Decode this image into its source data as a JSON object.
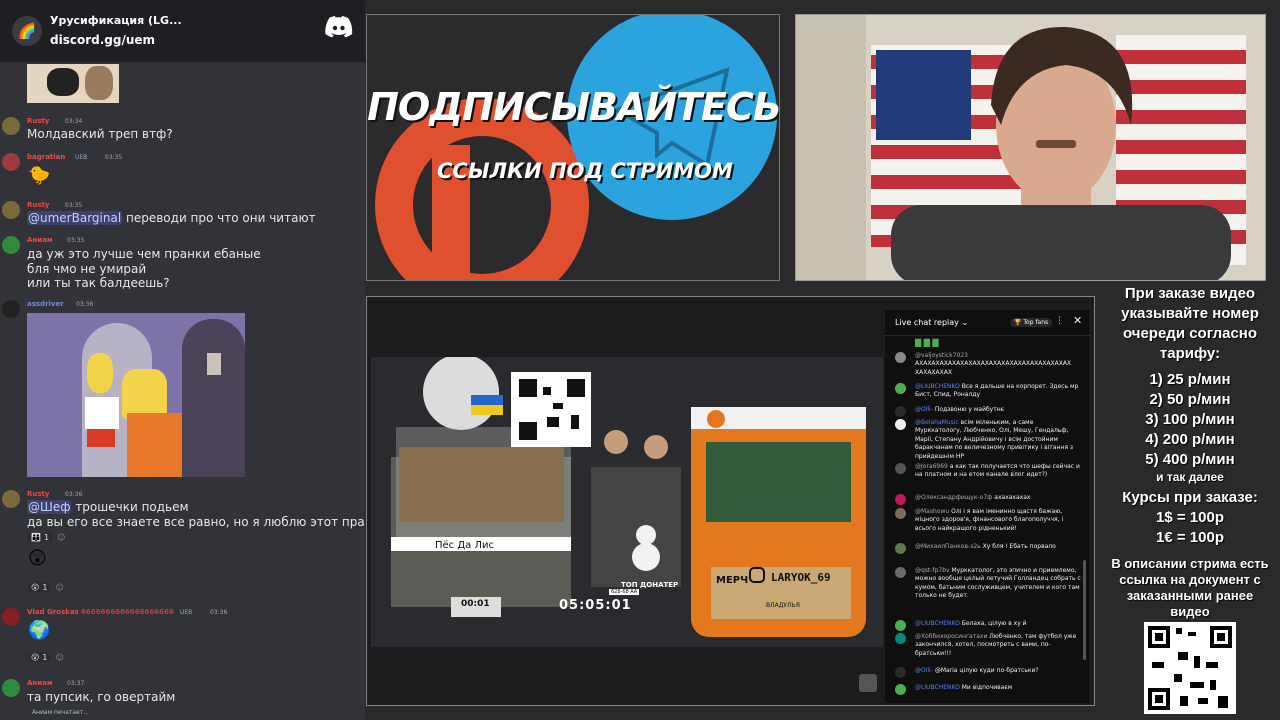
{
  "discord": {
    "server_name": "Урусификация (LG...",
    "invite": "discord.gg/uem",
    "typing": "Аниам печатает...",
    "messages": [
      {
        "user": "Rusty",
        "time": "03:34",
        "text": "Молдавский треп втф?"
      },
      {
        "user": "bagratian",
        "tag": "UEB",
        "time": "03:35"
      },
      {
        "user": "Rusty",
        "time": "03:35",
        "mention": "@umerBarginal",
        "text": "переводи про что они читают"
      },
      {
        "user": "Аниам",
        "time": "03:35",
        "lines": [
          "да уж это лучше чем пранки ебаные",
          "бля чмо не умирай",
          "или ты так балдеешь?"
        ]
      },
      {
        "user": "assdriver",
        "time": "03:36"
      },
      {
        "user": "Rusty",
        "time": "03:36",
        "mention": "@Шеф",
        "text": "трошечки подьем",
        "line2": "да вы его все знаете все равно, но я люблю этот пранк",
        "reaction_count": "1",
        "reaction2_count": "1"
      },
      {
        "user": "Vlad Groskas",
        "nick_suffix": "6666666666666666666",
        "tag": "UEB",
        "time": "03:36",
        "reaction_count": "1"
      },
      {
        "user": "Аниам",
        "time": "03:37",
        "text": "та пупсик, го овертайм"
      }
    ]
  },
  "promo": {
    "line1": "ПОДПИСЫВАЙТЕСЬ",
    "line2": "ССЫЛКИ ПОД СТРИМОМ"
  },
  "game": {
    "timer": "05:05:01",
    "left_plate": "Пёс Да Лис",
    "left_counter": "00:01",
    "merch_label": "МЕРЧ",
    "merch_handle": "LARYOK_69",
    "top_donater": "ТОП ДОНАТЕР",
    "plate_left": "628-68 АА",
    "plate_right": "ВЛАДУЛЬЯ"
  },
  "live_chat": {
    "title": "Live chat replay",
    "top_fans": "Top fans",
    "messages": [
      {
        "name": "@valjoystick7023",
        "text": "АХАХАХАХАХАХАХАХАХАХАХАХАХАХАХАХАХАХАХ ХАХАХАХАХ",
        "color": "#8a8a8a"
      },
      {
        "name": "@LIUBCHENKO",
        "mod": true,
        "text": "Все я дальше на корпорет. Здесь мр Бист, Спид, Роналду",
        "color": "#4caf50"
      },
      {
        "name": "@Olli-",
        "mod": true,
        "text": "Подзвоню у майбутнє",
        "color": "#2a2a2a"
      },
      {
        "name": "@BelahaMusic",
        "mod": true,
        "text": "всім міленьким, а саме Мурккатологу, Любченко, Олі, Мешу, Гендальф, Марії, Степану Андрійовичу і всім достойним баракчанам по величезному привітику і вітання з прийдешнім НР",
        "color": "#eeeeee"
      },
      {
        "name": "@Jora6969",
        "text": "а как так получается что шефы сейчас и на платном и на етом канале влог идет?)",
        "color": "#555555"
      },
      {
        "name": "@Олександрфищук-о7ф",
        "text": "ахахахахах",
        "color": "#c2185b"
      },
      {
        "name": "@Mashowu",
        "text": "Олі і я вам іменинно щастя бажаю, міцного здоров'я, фінансового благополуччя, і всього найкращого рідненький!",
        "color": "#7e6b5a"
      },
      {
        "name": "@МихаилПанков-з2ь",
        "text": "Ху бля ! Ебать порвало",
        "color": "#5d7a4a"
      },
      {
        "name": "@qst-fp7bv",
        "text": "Мурккатолог, это эпично и приемлемо, можно вообще целый летучий Голландец собрать с кумом, батьним сослуживцем, учителем и кого там только не будет.",
        "color": "#6b6b6b"
      },
      {
        "name": "@LIUBCHENKO",
        "mod": true,
        "text": "Белаха, цілую в ху й",
        "color": "#4caf50"
      },
      {
        "name": "@Хоббихоросингатахи",
        "text": "Любченко, там футбол уже закончился, хотел, посмотреть с вами, по-братськи!!!",
        "color": "#00897b"
      },
      {
        "name": "@Olli-",
        "mod": true,
        "text": "@Maria цілую куди по-братськи?",
        "color": "#2a2a2a"
      },
      {
        "name": "@LIUBCHENKO",
        "mod": true,
        "text": "Ми відпочиваєм",
        "color": "#4caf50"
      }
    ]
  },
  "info": {
    "intro": "При заказе видео указывайте номер очереди согласно тарифу:",
    "tariffs": [
      "1) 25 р/мин",
      "2) 50 р/мин",
      "3) 100 р/мин",
      "4) 200 р/мин",
      "5) 400 р/мин"
    ],
    "etc": "и так далее",
    "rates_title": "Курсы при заказе:",
    "rates": [
      "1$ = 100р",
      "1€ = 100р"
    ],
    "note": "В описании стрима есть ссылка на документ с заказанными ранее видео"
  },
  "colors": {
    "discord_bg": "#313338",
    "telegram_blue": "#2aa3df",
    "patreon_orange": "#e0502e",
    "username_red": "#f04747",
    "username_blue": "#7289da"
  }
}
